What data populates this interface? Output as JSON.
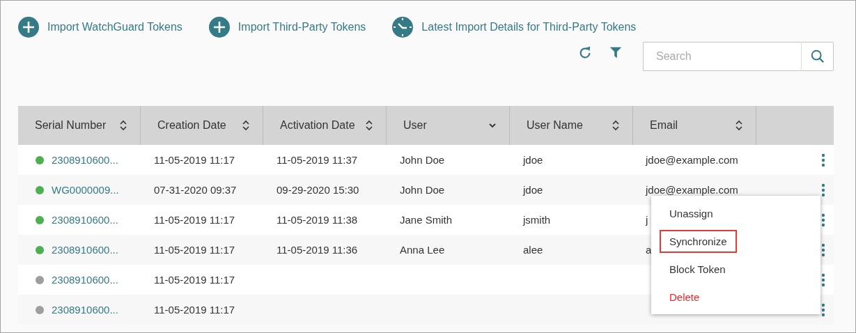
{
  "actions": [
    {
      "kind": "add",
      "label": "Import WatchGuard Tokens"
    },
    {
      "kind": "add",
      "label": "Import Third-Party Tokens"
    },
    {
      "kind": "clock",
      "label": "Latest Import Details for Third-Party Tokens"
    }
  ],
  "search": {
    "placeholder": "Search"
  },
  "table": {
    "columns": [
      {
        "label": "Serial Number",
        "kind": "sort"
      },
      {
        "label": "Creation Date",
        "kind": "sort"
      },
      {
        "label": "Activation Date",
        "kind": "sort"
      },
      {
        "label": "User",
        "kind": "dropdown"
      },
      {
        "label": "User Name",
        "kind": "sort"
      },
      {
        "label": "Email",
        "kind": "sort"
      }
    ],
    "rows": [
      {
        "color": "#4caf50",
        "serial": "2308910600...",
        "created": "11-05-2019 11:17",
        "activated": "11-05-2019 11:37",
        "user": "John Doe",
        "user_name": "jdoe",
        "email": "jdoe@example.com"
      },
      {
        "color": "#4caf50",
        "serial": "WG0000009...",
        "created": "07-31-2020 09:37",
        "activated": "09-29-2020 15:30",
        "user": "John Doe",
        "user_name": "jdoe",
        "email": "jdoe@example.com"
      },
      {
        "color": "#4caf50",
        "serial": "2308910600...",
        "created": "11-05-2019 11:17",
        "activated": "11-05-2019 11:38",
        "user": "Jane Smith",
        "user_name": "jsmith",
        "email": "j"
      },
      {
        "color": "#4caf50",
        "serial": "2308910600...",
        "created": "11-05-2019 11:17",
        "activated": "11-05-2019 11:36",
        "user": "Anna Lee",
        "user_name": "alee",
        "email": "a"
      },
      {
        "color": "#9e9e9e",
        "serial": "2308910600...",
        "created": "11-05-2019 11:17"
      },
      {
        "color": "#9e9e9e",
        "serial": "2308910600...",
        "created": "11-05-2019 11:17"
      }
    ]
  },
  "context_menu": {
    "items": [
      {
        "label": "Unassign",
        "kind": "normal",
        "highlighted": false
      },
      {
        "label": "Synchronize",
        "kind": "normal",
        "highlighted": true
      },
      {
        "label": "Block Token",
        "kind": "normal",
        "highlighted": false
      },
      {
        "label": "Delete",
        "kind": "danger",
        "highlighted": false
      }
    ]
  }
}
